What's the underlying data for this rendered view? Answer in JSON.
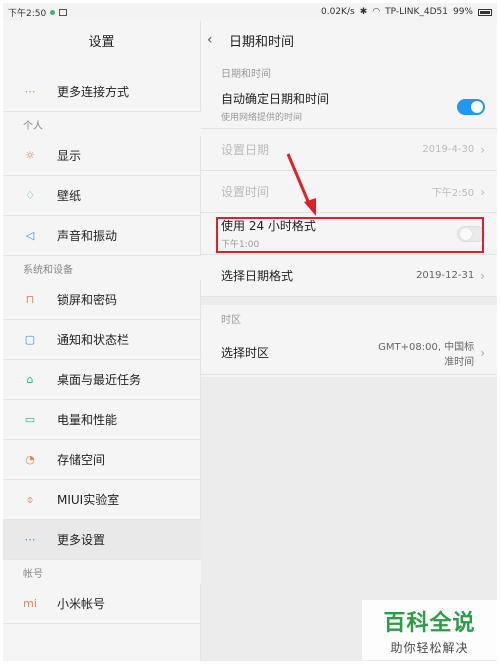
{
  "status_bar": {
    "time": "下午2:50",
    "speed": "0.02K/s",
    "wifi_name": "TP-LINK_4D51",
    "battery": "99%",
    "icons": [
      "location-dot-icon",
      "image-icon",
      "bluetooth-icon",
      "wifi-icon",
      "battery-icon"
    ]
  },
  "left_pane": {
    "title": "设置",
    "items": [
      {
        "type": "item",
        "label": "更多连接方式",
        "icon": "dots-icon",
        "glyph": "⋯"
      },
      {
        "type": "section",
        "label": "个人"
      },
      {
        "type": "item",
        "label": "显示",
        "icon": "sun-icon",
        "glyph": "☼"
      },
      {
        "type": "item",
        "label": "壁纸",
        "icon": "wallpaper-icon",
        "glyph": "♢",
        "color": "#2bb673"
      },
      {
        "type": "item",
        "label": "声音和振动",
        "icon": "speaker-icon",
        "glyph": "◁",
        "color": "#3a8ee6"
      },
      {
        "type": "section",
        "label": "系统和设备"
      },
      {
        "type": "item",
        "label": "锁屏和密码",
        "icon": "lock-icon",
        "glyph": "⊓"
      },
      {
        "type": "item",
        "label": "通知和状态栏",
        "icon": "notification-icon",
        "glyph": "▢",
        "color": "#3a8ee6"
      },
      {
        "type": "item",
        "label": "桌面与最近任务",
        "icon": "home-icon",
        "glyph": "⌂",
        "color": "#2bb673"
      },
      {
        "type": "item",
        "label": "电量和性能",
        "icon": "battery-icon",
        "glyph": "▭",
        "color": "#2bb673"
      },
      {
        "type": "item",
        "label": "存储空间",
        "icon": "storage-icon",
        "glyph": "◔"
      },
      {
        "type": "item",
        "label": "MIUI实验室",
        "icon": "flask-icon",
        "glyph": "⌽"
      },
      {
        "type": "item",
        "label": "更多设置",
        "icon": "dots-icon",
        "glyph": "⋯",
        "active": true,
        "color": "#3a8ee6"
      },
      {
        "type": "section",
        "label": "帐号"
      },
      {
        "type": "item",
        "label": "小米帐号",
        "icon": "mi-icon",
        "glyph": "mi"
      }
    ]
  },
  "right_pane": {
    "title": "日期和时间",
    "back_icon": "chevron-left-icon",
    "section_datetime": "日期和时间",
    "auto_title": "自动确定日期和时间",
    "auto_sub": "使用网络提供的时间",
    "auto_on": true,
    "set_date_title": "设置日期",
    "set_date_value": "2019-4-30",
    "set_time_title": "设置时间",
    "set_time_value": "下午2:50",
    "h24_title": "使用 24 小时格式",
    "h24_sub": "下午1:00",
    "h24_on": false,
    "date_format_title": "选择日期格式",
    "date_format_value": "2019-12-31",
    "section_timezone": "时区",
    "timezone_title": "选择时区",
    "timezone_value_line1": "GMT+08:00, 中国标",
    "timezone_value_line2": "准时间"
  },
  "annotation": {
    "arrow_color": "#d9232a",
    "box_color": "#d9232a"
  },
  "watermark": {
    "title": "百科全说",
    "subtitle": "助你轻松解决"
  }
}
